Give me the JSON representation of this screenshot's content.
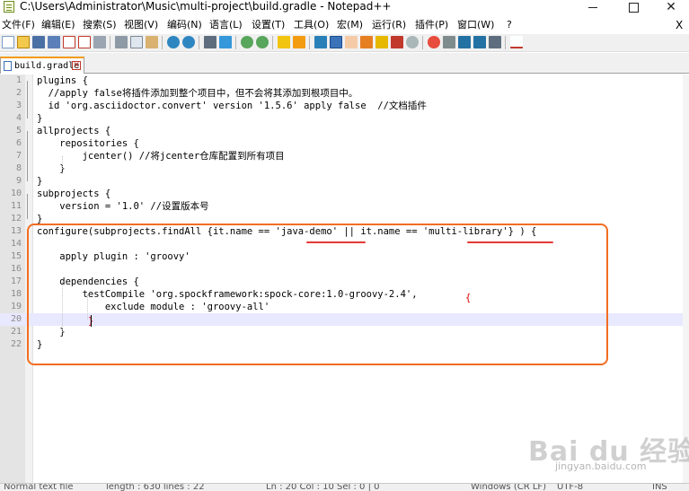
{
  "window": {
    "title": "C:\\Users\\Administrator\\Music\\multi-project\\build.gradle - Notepad++",
    "close_glyph": "✕"
  },
  "menu": {
    "items": [
      "文件(F)",
      "编辑(E)",
      "搜索(S)",
      "视图(V)",
      "编码(N)",
      "语言(L)",
      "设置(T)",
      "工具(O)",
      "宏(M)",
      "运行(R)",
      "插件(P)",
      "窗口(W)",
      "?"
    ],
    "close_label": "X"
  },
  "toolbar": {
    "icons": [
      "new-file-icon",
      "open-file-icon",
      "save-icon",
      "save-all-icon",
      "close-icon",
      "close-all-icon",
      "print-icon",
      "cut-icon",
      "copy-icon",
      "paste-icon",
      "undo-icon",
      "redo-icon",
      "find-icon",
      "replace-icon",
      "zoom-in-icon",
      "zoom-out-icon",
      "sync-scroll-icon",
      "word-wrap-icon",
      "show-all-chars-icon",
      "indent-guide-icon",
      "doc-map-icon",
      "function-list-icon",
      "folder-workspace-icon",
      "monitor-icon",
      "record-macro-icon",
      "stop-record-icon",
      "play-macro-icon",
      "run-macro-multiple-icon",
      "save-macro-icon",
      "spell-check-icon"
    ]
  },
  "tab": {
    "label": "build.gradle",
    "close_glyph": "✕"
  },
  "editor": {
    "lines": [
      {
        "num": "1",
        "text": "plugins {"
      },
      {
        "num": "2",
        "text": "  //apply false将插件添加到整个项目中，但不会将其添加到根项目中。"
      },
      {
        "num": "3",
        "text": "  id 'org.asciidoctor.convert' version '1.5.6' apply false  //文档插件"
      },
      {
        "num": "4",
        "text": "}"
      },
      {
        "num": "5",
        "text": "allprojects {"
      },
      {
        "num": "6",
        "text": "    repositories {"
      },
      {
        "num": "7",
        "text": "        jcenter() //将jcenter仓库配置到所有项目"
      },
      {
        "num": "8",
        "text": "    }"
      },
      {
        "num": "9",
        "text": "}"
      },
      {
        "num": "10",
        "text": "subprojects {"
      },
      {
        "num": "11",
        "text": "    version = '1.0' //设置版本号"
      },
      {
        "num": "12",
        "text": "}"
      },
      {
        "num": "13",
        "text": "configure(subprojects.findAll {it.name == 'java-demo' || it.name == 'multi-library'} ) {"
      },
      {
        "num": "14",
        "text": ""
      },
      {
        "num": "15",
        "text": "    apply plugin : 'groovy'"
      },
      {
        "num": "16",
        "text": ""
      },
      {
        "num": "17",
        "text": "    dependencies {"
      },
      {
        "num": "18",
        "text": "        testCompile 'org.spockframework:spock-core:1.0-groovy-2.4', "
      },
      {
        "num": "19",
        "text": "            exclude module : 'groovy-all'"
      },
      {
        "num": "20",
        "text": "        "
      },
      {
        "num": "21",
        "text": "    }"
      },
      {
        "num": "22",
        "text": "}"
      }
    ],
    "highlight_brace_open": "{",
    "highlight_brace_close": "}",
    "current_line": 20
  },
  "statusbar": {
    "items": [
      "Normal text file",
      "length : 630    lines : 22",
      "Ln : 20    Col : 10    Sel : 0 | 0",
      "Windows (CR LF)",
      "UTF-8",
      "INS"
    ]
  },
  "watermark": {
    "logo": "Bai du 经验",
    "url": "jingyan.baidu.com"
  },
  "colors": {
    "annotation_box": "#f26d21",
    "underline": "#e53935",
    "current_line": "#e8e8ff",
    "tab_accent": "#f39c12"
  }
}
